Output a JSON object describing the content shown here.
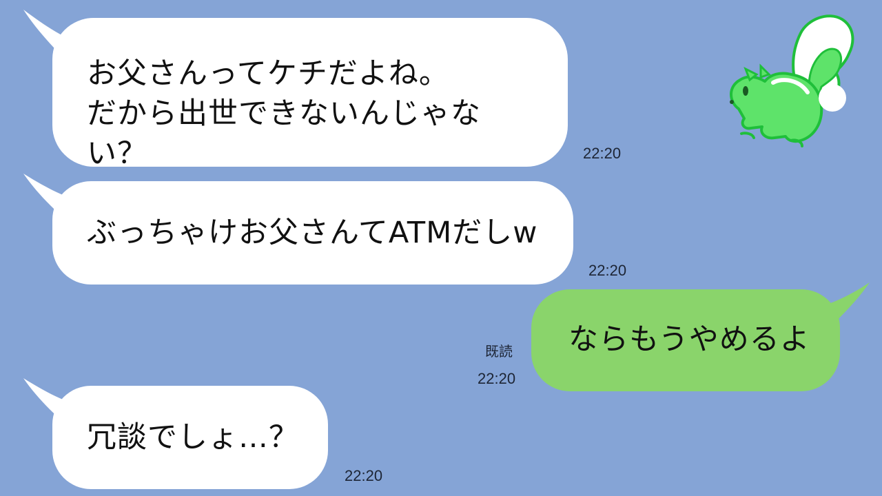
{
  "messages": [
    {
      "sender": "other",
      "text": "お父さんってケチだよね。\nだから出世できないんじゃない？",
      "time": "22:20"
    },
    {
      "sender": "other",
      "text": "ぶっちゃけお父さんてATMだしw",
      "time": "22:20"
    },
    {
      "sender": "me",
      "text": "ならもうやめるよ",
      "time": "22:20",
      "read_label": "既読"
    },
    {
      "sender": "other",
      "text": "冗談でしょ…？",
      "time": "22:20"
    }
  ],
  "colors": {
    "background": "#85a4d6",
    "incoming_bubble": "#ffffff",
    "outgoing_bubble": "#8ad46b",
    "sticker_green": "#5ee36a"
  },
  "icons": {
    "sticker": "skunk-icon"
  }
}
